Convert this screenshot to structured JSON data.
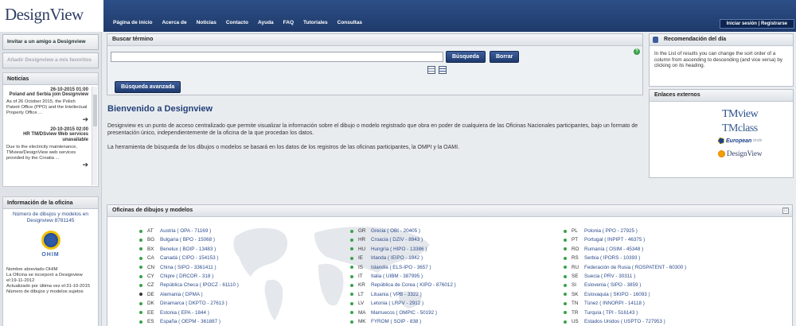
{
  "header": {
    "logo": "DesignView",
    "nav": [
      "Página de inicio",
      "Acerca de",
      "Noticias",
      "Contacto",
      "Ayuda",
      "FAQ",
      "Tutoriales",
      "Consultas"
    ],
    "login": "Iniciar sesión | Registrarse"
  },
  "left": {
    "invite": "Invitar a un amigo a Designview",
    "favorites": "Añadir Designview a mis favoritos",
    "news_title": "Noticias",
    "news": [
      {
        "date": "26-10-2015 01:00",
        "title": "Poland and Serbia join Designview",
        "text": "As of 26 October 2015, the Polish Patent Office (PPO) and the Intellectual Property Office ..."
      },
      {
        "date": "20-10-2015 02:00",
        "title": "HR TM/DSview Web services unavailable",
        "text": "Due to the electricity maintenance, TMview/DesignView web services provided by the Croatia ..."
      }
    ],
    "office_title": "Información de la oficina",
    "office_link": "Número de dibujos y modelos en Designview 8781145",
    "office_logo": "OHIM",
    "office_meta": [
      "Nombre abreviado OHIM",
      "La Oficina se incorporó a Designview el:19-11-2012",
      "Actualizado por última vez el:31-10-2015",
      "Número de dibujos y modelos sujetos"
    ]
  },
  "search": {
    "title": "Buscar término",
    "input_value": "",
    "search_btn": "Búsqueda",
    "clear_btn": "Borrar",
    "help": "?",
    "advanced_btn": "Búsqueda avanzada"
  },
  "welcome": {
    "title": "Bienvenido a Designview",
    "p1": "Designview es un punto de acceso centralizado que permite visualizar la información sobre el dibujo o modelo registrado que obra en poder de cualquiera de las Oficinas Nacionales participantes, bajo un formato de presentación único, independientemente de la oficina de la que procedan los datos.",
    "p2": "La herramienta de búsqueda de los dibujos o modelos se basará en los datos de los registros de las oficinas participantes, la OMPI y la OAMI."
  },
  "offices": {
    "title": "Oficinas de dibujos y modelos",
    "columns": [
      [
        {
          "code": "AT",
          "name": "Austria ( OPA - 71169 )",
          "active": true
        },
        {
          "code": "BG",
          "name": "Bulgaria ( BPO - 15068 )",
          "active": true
        },
        {
          "code": "BX",
          "name": "Benelux ( BOIP - 13483 )",
          "active": true
        },
        {
          "code": "CA",
          "name": "Canadá ( CIPO - 154153 )",
          "active": true
        },
        {
          "code": "CN",
          "name": "China ( SIPO - 3361411 )",
          "active": true
        },
        {
          "code": "CY",
          "name": "Chipre ( DRCOR - 318 )",
          "active": true
        },
        {
          "code": "CZ",
          "name": "República Checa ( IPOCZ - 61110 )",
          "active": true
        },
        {
          "code": "DE",
          "name": "Alemania ( DPMA )",
          "active": false
        },
        {
          "code": "DK",
          "name": "Dinamarca ( DKPTO - 27613 )",
          "active": true
        },
        {
          "code": "EE",
          "name": "Estonia ( EPA - 1844 )",
          "active": true
        },
        {
          "code": "ES",
          "name": "España ( OEPM - 361887 )",
          "active": true
        }
      ],
      [
        {
          "code": "GR",
          "name": "Grecia ( OBI - 20405 )",
          "active": true
        },
        {
          "code": "HR",
          "name": "Croacia ( DZIV - 8943 )",
          "active": true
        },
        {
          "code": "HU",
          "name": "Hungría ( HIPO - 13386 )",
          "active": true
        },
        {
          "code": "IE",
          "name": "Irlanda ( IEIPO - 1942 )",
          "active": true
        },
        {
          "code": "IS",
          "name": "Islandia ( ELS-IPO - 3657 )",
          "active": true
        },
        {
          "code": "IT",
          "name": "Italia ( UIBM - 387995 )",
          "active": true
        },
        {
          "code": "KR",
          "name": "República de Corea ( KIPO - 876012 )",
          "active": true
        },
        {
          "code": "LT",
          "name": "Lituania ( VPB - 3322 )",
          "active": true
        },
        {
          "code": "LV",
          "name": "Letonia ( LRPV - 2912 )",
          "active": true
        },
        {
          "code": "MA",
          "name": "Marruecos ( OMPIC - 50192 )",
          "active": true
        },
        {
          "code": "MK",
          "name": "FYROM ( SOIP - 838 )",
          "active": true
        }
      ],
      [
        {
          "code": "PL",
          "name": "Polonia ( PPO - 27925 )",
          "active": true
        },
        {
          "code": "PT",
          "name": "Portugal ( INPIPT - 46375 )",
          "active": true
        },
        {
          "code": "RO",
          "name": "Rumanía ( OSIM - 45348 )",
          "active": true
        },
        {
          "code": "RS",
          "name": "Serbia ( IPORS - 10393 )",
          "active": true
        },
        {
          "code": "RU",
          "name": "Federación de Rusia ( ROSPATENT - 60300 )",
          "active": true
        },
        {
          "code": "SE",
          "name": "Suecia ( PRV - 30311 )",
          "active": true
        },
        {
          "code": "SI",
          "name": "Eslovenia ( SIPO - 3859 )",
          "active": true
        },
        {
          "code": "SK",
          "name": "Eslovaquia ( SKIPO - 16093 )",
          "active": true
        },
        {
          "code": "TN",
          "name": "Túnez ( INNORPI - 14118 )",
          "active": true
        },
        {
          "code": "TR",
          "name": "Turquía ( TPI - 516143 )",
          "active": true
        },
        {
          "code": "US",
          "name": "Estados Unidos ( USPTO - 727953 )",
          "active": true
        }
      ]
    ]
  },
  "right": {
    "rec_title": "Recomendación del día",
    "rec_text": "In the List of results you can change the sort order of a column from ascending to descending (and vice versa) by clicking on its heading.",
    "links_title": "Enlaces externos",
    "logo_tmview": "TMview",
    "logo_tmclass": "TMclass",
    "logo_european": "European",
    "logo_european_small": "tmdn",
    "logo_designview": "DesignView"
  },
  "colors": {
    "brand": "#1f3a6a",
    "link": "#2c4c8c",
    "active_dot": "#39a24a"
  }
}
